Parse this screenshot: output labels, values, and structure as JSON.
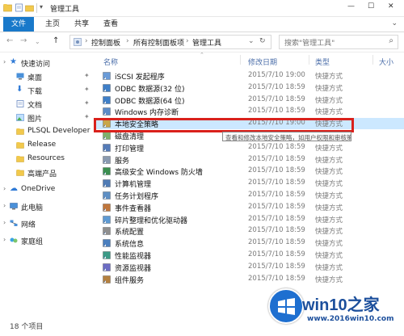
{
  "window": {
    "title": "管理工具"
  },
  "ribbon": {
    "tabs": [
      "文件",
      "主页",
      "共享",
      "查看"
    ]
  },
  "address": {
    "breadcrumb": [
      "控制面板",
      "所有控制面板项",
      "管理工具"
    ],
    "search_placeholder": "搜索\"管理工具\""
  },
  "nav": {
    "items": [
      {
        "label": "快速访问",
        "icon": "star-icon"
      },
      {
        "label": "桌面",
        "icon": "desktop-icon"
      },
      {
        "label": "下载",
        "icon": "download-icon"
      },
      {
        "label": "文档",
        "icon": "document-icon"
      },
      {
        "label": "图片",
        "icon": "picture-icon"
      },
      {
        "label": "PLSQL Developer",
        "icon": "folder-icon"
      },
      {
        "label": "Release",
        "icon": "folder-icon"
      },
      {
        "label": "Resources",
        "icon": "folder-icon"
      },
      {
        "label": "高端产品",
        "icon": "folder-icon"
      },
      {
        "label": "OneDrive",
        "icon": "cloud-icon"
      },
      {
        "label": "此电脑",
        "icon": "computer-icon"
      },
      {
        "label": "网络",
        "icon": "network-icon"
      },
      {
        "label": "家庭组",
        "icon": "homegroup-icon"
      }
    ]
  },
  "list": {
    "columns": [
      "名称",
      "修改日期",
      "类型",
      "大小"
    ],
    "rows": [
      {
        "name": "iSCSI 发起程序",
        "date": "2015/7/10 19:00",
        "type": "快捷方式"
      },
      {
        "name": "ODBC 数据源(32 位)",
        "date": "2015/7/10 18:59",
        "type": "快捷方式"
      },
      {
        "name": "ODBC 数据源(64 位)",
        "date": "2015/7/10 18:59",
        "type": "快捷方式"
      },
      {
        "name": "Windows 内存诊断",
        "date": "2015/7/10 18:59",
        "type": "快捷方式"
      },
      {
        "name": "本地安全策略",
        "date": "2015/7/10 19:00",
        "type": "快捷方式"
      },
      {
        "name": "磁盘清理",
        "date": "2015/7/10 18:59",
        "type": "快捷方式"
      },
      {
        "name": "打印管理",
        "date": "2015/7/10 18:59",
        "type": "快捷方式"
      },
      {
        "name": "服务",
        "date": "2015/7/10 18:59",
        "type": "快捷方式"
      },
      {
        "name": "高级安全 Windows 防火墙",
        "date": "2015/7/10 18:59",
        "type": "快捷方式"
      },
      {
        "name": "计算机管理",
        "date": "2015/7/10 18:59",
        "type": "快捷方式"
      },
      {
        "name": "任务计划程序",
        "date": "2015/7/10 18:59",
        "type": "快捷方式"
      },
      {
        "name": "事件查看器",
        "date": "2015/7/10 18:59",
        "type": "快捷方式"
      },
      {
        "name": "碎片整理和优化驱动器",
        "date": "2015/7/10 18:59",
        "type": "快捷方式"
      },
      {
        "name": "系统配置",
        "date": "2015/7/10 18:59",
        "type": "快捷方式"
      },
      {
        "name": "系统信息",
        "date": "2015/7/10 18:59",
        "type": "快捷方式"
      },
      {
        "name": "性能监视器",
        "date": "2015/7/10 18:59",
        "type": "快捷方式"
      },
      {
        "name": "资源监视器",
        "date": "2015/7/10 18:59",
        "type": "快捷方式"
      },
      {
        "name": "组件服务",
        "date": "2015/7/10 18:59",
        "type": "快捷方式"
      }
    ],
    "tooltip": "查看和修改本地安全策略，如用户权限和审核策略。"
  },
  "status": {
    "count": "18 个项目"
  },
  "watermark": {
    "title": "win10之家",
    "url": "www.2016win10.com"
  },
  "colors": {
    "accent": "#1979ca",
    "highlight": "#d9211c",
    "selected_row": "#cce8ff"
  }
}
